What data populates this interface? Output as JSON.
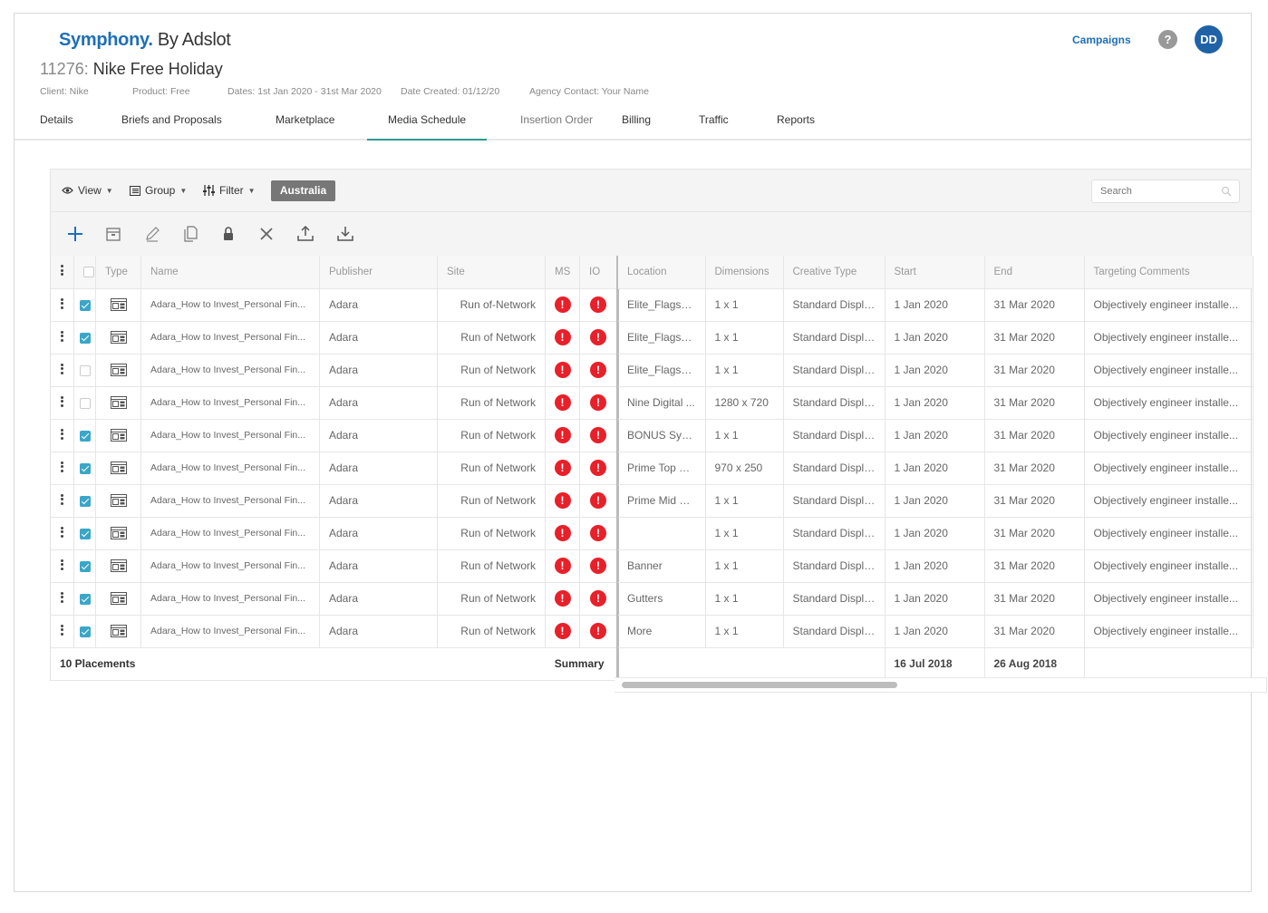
{
  "header": {
    "brand": "Symphony.",
    "by": "By Adslot",
    "campaign_id": "11276:",
    "campaign_name": "Nike Free Holiday",
    "meta": {
      "client": "Client: Nike",
      "product": "Product: Free",
      "dates": "Dates: 1st Jan 2020 - 31st Mar 2020",
      "created": "Date Created: 01/12/20",
      "agency_contact": "Agency Contact:  Your Name"
    },
    "campaigns_link": "Campaigns",
    "help": "?",
    "avatar": "DD"
  },
  "tabs": [
    {
      "label": "Details"
    },
    {
      "label": "Briefs and Proposals"
    },
    {
      "label": "Marketplace"
    },
    {
      "label": "Media Schedule",
      "active": true
    },
    {
      "label": "Insertion Order"
    },
    {
      "label": "Billing"
    },
    {
      "label": "Traffic"
    },
    {
      "label": "Reports"
    }
  ],
  "toolbar": {
    "view": "View",
    "group": "Group",
    "filter": "Filter",
    "region": "Australia",
    "search_placeholder": "Search"
  },
  "actions": [
    "add-icon",
    "archive-icon",
    "edit-icon",
    "copy-icon",
    "lock-icon",
    "delete-icon",
    "upload-icon",
    "download-icon"
  ],
  "columns_left": [
    "Type",
    "Name",
    "Publisher",
    "Site",
    "MS",
    "IO"
  ],
  "columns_right": [
    "Location",
    "Dimensions",
    "Creative Type",
    "Start",
    "End",
    "Targeting Comments"
  ],
  "rows": [
    {
      "checked": true,
      "name": "Adara_How to Invest_Personal Fin...",
      "publisher": "Adara",
      "site": "Run of-Network",
      "location": "Elite_Flagsh...",
      "dimensions": "1 x 1",
      "creative": "Standard Display",
      "start": "1 Jan 2020",
      "end": "31 Mar 2020",
      "comments": "Objectively engineer installe..."
    },
    {
      "checked": true,
      "name": "Adara_How to Invest_Personal Fin...",
      "publisher": "Adara",
      "site": "Run of Network",
      "location": "Elite_Flagsh...",
      "dimensions": "1 x 1",
      "creative": "Standard Display",
      "start": "1 Jan 2020",
      "end": "31 Mar 2020",
      "comments": "Objectively engineer installe..."
    },
    {
      "checked": false,
      "name": "Adara_How to Invest_Personal Fin...",
      "publisher": "Adara",
      "site": "Run of Network",
      "location": "Elite_Flagsh...",
      "dimensions": "1 x 1",
      "creative": "Standard Display",
      "start": "1 Jan 2020",
      "end": "31 Mar 2020",
      "comments": "Objectively engineer installe..."
    },
    {
      "checked": false,
      "name": "Adara_How to Invest_Personal Fin...",
      "publisher": "Adara",
      "site": "Run of Network",
      "location": "Nine Digital ...",
      "dimensions": "1280 x 720",
      "creative": "Standard Display",
      "start": "1 Jan 2020",
      "end": "31 Mar 2020",
      "comments": "Objectively engineer installe..."
    },
    {
      "checked": true,
      "name": "Adara_How to Invest_Personal Fin...",
      "publisher": "Adara",
      "site": "Run of Network",
      "location": "BONUS Syd ...",
      "dimensions": "1 x 1",
      "creative": "Standard Display",
      "start": "1 Jan 2020",
      "end": "31 Mar 2020",
      "comments": "Objectively engineer installe..."
    },
    {
      "checked": true,
      "name": "Adara_How to Invest_Personal Fin...",
      "publisher": "Adara",
      "site": "Run of Network",
      "location": "Prime Top C...",
      "dimensions": "970 x 250",
      "creative": "Standard Display",
      "start": "1 Jan 2020",
      "end": "31 Mar 2020",
      "comments": "Objectively engineer installe..."
    },
    {
      "checked": true,
      "name": "Adara_How to Invest_Personal Fin...",
      "publisher": "Adara",
      "site": "Run of Network",
      "location": "Prime Mid C...",
      "dimensions": "1 x 1",
      "creative": "Standard Display",
      "start": "1 Jan 2020",
      "end": "31 Mar 2020",
      "comments": "Objectively engineer installe..."
    },
    {
      "checked": true,
      "name": "Adara_How to Invest_Personal Fin...",
      "publisher": "Adara",
      "site": "Run of Network",
      "location": "",
      "dimensions": "1 x 1",
      "creative": "Standard Display",
      "start": "1 Jan 2020",
      "end": "31 Mar 2020",
      "comments": "Objectively engineer installe..."
    },
    {
      "checked": true,
      "name": "Adara_How to Invest_Personal Fin...",
      "publisher": "Adara",
      "site": "Run of Network",
      "location": "Banner",
      "dimensions": "1 x 1",
      "creative": "Standard Display",
      "start": "1 Jan 2020",
      "end": "31 Mar 2020",
      "comments": "Objectively engineer installe..."
    },
    {
      "checked": true,
      "name": "Adara_How to Invest_Personal Fin...",
      "publisher": "Adara",
      "site": "Run of Network",
      "location": "Gutters",
      "dimensions": "1 x 1",
      "creative": "Standard Display",
      "start": "1 Jan 2020",
      "end": "31 Mar 2020",
      "comments": "Objectively engineer installe..."
    },
    {
      "checked": true,
      "name": "Adara_How to Invest_Personal Fin...",
      "publisher": "Adara",
      "site": "Run of Network",
      "location": "More",
      "dimensions": "1 x 1",
      "creative": "Standard Display",
      "start": "1 Jan 2020",
      "end": "31 Mar 2020",
      "comments": "Objectively engineer installe..."
    }
  ],
  "row_status": {
    "ms": "!",
    "io": "!"
  },
  "footer": {
    "placements": "10 Placements",
    "summary": "Summary",
    "start_total": "16 Jul 2018",
    "end_total": "26 Aug 2018"
  },
  "colors": {
    "brand": "#1e6fb8",
    "active_tab": "#2a9d8f",
    "error": "#e8202a",
    "checkbox": "#3aa6c9"
  }
}
